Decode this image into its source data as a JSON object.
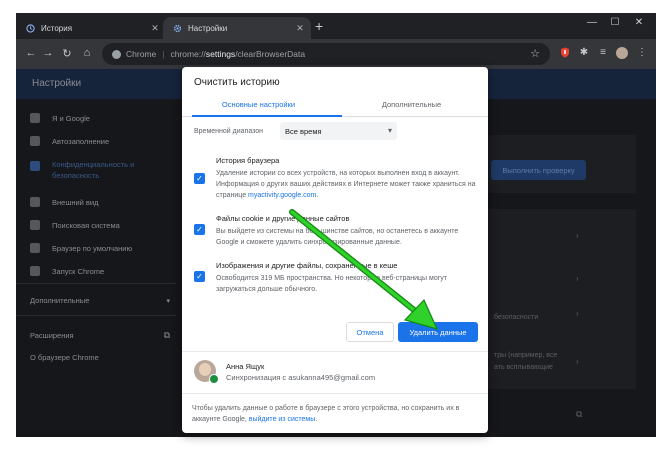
{
  "tabs": [
    {
      "title": "История"
    },
    {
      "title": "Настройки"
    }
  ],
  "toolbar": {
    "omnibox_site": "Chrome",
    "omnibox_url_prefix": "chrome://",
    "omnibox_url_host": "settings",
    "omnibox_url_path": "/clearBrowserData"
  },
  "settings": {
    "title": "Настройки",
    "sidebar": [
      {
        "label": "Я и Google"
      },
      {
        "label": "Автозаполнение"
      },
      {
        "label": "Конфиденциальность и безопасность"
      },
      {
        "label": "Внешний вид"
      },
      {
        "label": "Поисковая система"
      },
      {
        "label": "Браузер по умолчанию"
      },
      {
        "label": "Запуск Chrome"
      },
      {
        "label": "Дополнительные"
      },
      {
        "label": "Расширения"
      },
      {
        "label": "О браузере Chrome"
      }
    ],
    "check_button": "Выполнить проверку",
    "content_security": "безопасности",
    "content_line1": "тры (например, все",
    "content_line2": "ать всплывающие"
  },
  "dialog": {
    "title": "Очистить историю",
    "tab_basic": "Основные настройки",
    "tab_advanced": "Дополнительные",
    "range_label": "Временной диапазон",
    "range_value": "Все время",
    "options": [
      {
        "title": "История браузера",
        "desc": "Удаление истории со всех устройств, на которых выполнен вход в аккаунт. Информация о других ваших действиях в Интернете может также храниться на странице ",
        "link": "myactivity.google.com",
        "desc_end": ".",
        "checked": true
      },
      {
        "title": "Файлы cookie и другие данные сайтов",
        "desc": "Вы выйдете из системы на большинстве сайтов, но останетесь в аккаунте Google и сможете удалить синхронизированные данные.",
        "checked": true
      },
      {
        "title": "Изображения и другие файлы, сохраненные в кеше",
        "desc": "Освободится 319 МБ пространства. Но некоторые веб-страницы могут загружаться дольше обычного.",
        "checked": true
      }
    ],
    "cancel_label": "Отмена",
    "clear_label": "Удалить данные",
    "account_name": "Анна Ящук",
    "account_sync": "Синхронизация с asukanna495@gmail.com",
    "footer_text": "Чтобы удалить данные о работе в браузере с этого устройства, но сохранить их в аккаунте Google, ",
    "footer_link": "выйдите из системы",
    "footer_end": "."
  },
  "colors": {
    "accent": "#1a73e8",
    "annotation_arrow": "#2fd12a"
  }
}
